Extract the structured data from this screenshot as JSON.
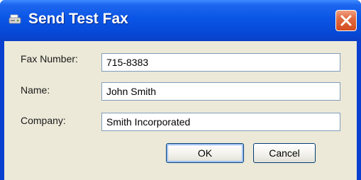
{
  "window": {
    "title": "Send Test Fax",
    "icon": "fax-icon",
    "accent": "#0a55e6",
    "close_color": "#d24d1f"
  },
  "form": {
    "fax_number": {
      "label": "Fax Number:",
      "value": "715-8383"
    },
    "name": {
      "label": "Name:",
      "value": "John Smith"
    },
    "company": {
      "label": "Company:",
      "value": "Smith Incorporated"
    }
  },
  "buttons": {
    "ok": "OK",
    "cancel": "Cancel"
  }
}
